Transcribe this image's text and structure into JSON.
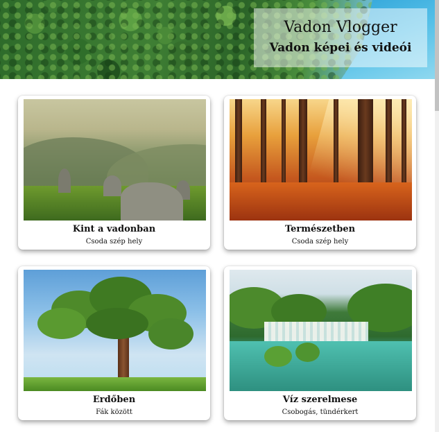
{
  "header": {
    "title": "Vadon Vlogger",
    "subtitle": "Vadon képei és videói"
  },
  "cards": [
    {
      "title": "Kint a vadonban",
      "description": "Csoda szép hely",
      "image": "mountain-valley-photo"
    },
    {
      "title": "Természetben",
      "description": "Csoda szép hely",
      "image": "sunlit-forest-photo"
    },
    {
      "title": "Erdőben",
      "description": "Fák között",
      "image": "lone-tree-photo"
    },
    {
      "title": "Víz szerelmese",
      "description": "Csobogás, tündérkert",
      "image": "waterfall-lake-photo"
    }
  ]
}
